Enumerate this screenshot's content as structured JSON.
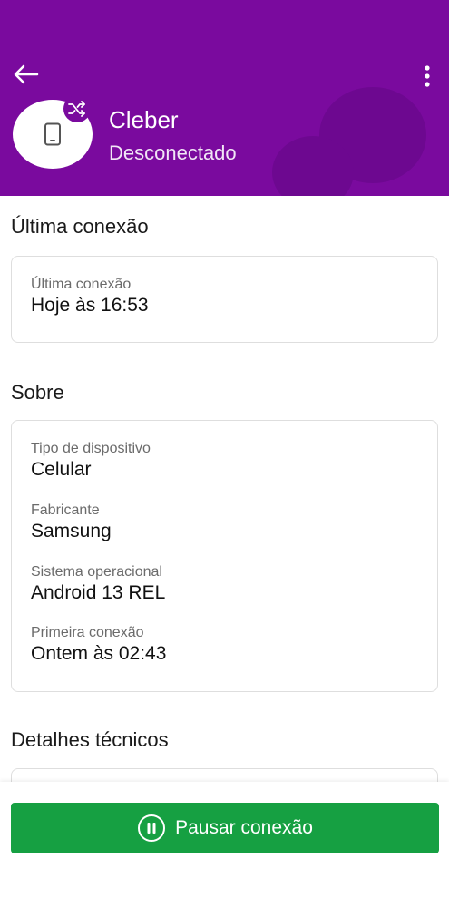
{
  "colors": {
    "header_bg": "#7a0a9e",
    "primary_button": "#16a042"
  },
  "header": {
    "back_icon": "arrow-left-icon",
    "more_icon": "more-vertical-icon",
    "device_icon": "phone-icon",
    "badge_icon": "shuffle-icon",
    "name": "Cleber",
    "status": "Desconectado"
  },
  "last_connection": {
    "section_title": "Última conexão",
    "label": "Última conexão",
    "value": "Hoje às 16:53"
  },
  "about": {
    "section_title": "Sobre",
    "fields": [
      {
        "label": "Tipo de dispositivo",
        "value": "Celular"
      },
      {
        "label": "Fabricante",
        "value": "Samsung"
      },
      {
        "label": "Sistema operacional",
        "value": "Android 13 REL"
      },
      {
        "label": "Primeira conexão",
        "value": "Ontem às 02:43"
      }
    ]
  },
  "technical": {
    "section_title": "Detalhes técnicos"
  },
  "footer": {
    "pause_label": "Pausar conexão",
    "pause_icon": "pause-circle-icon"
  }
}
